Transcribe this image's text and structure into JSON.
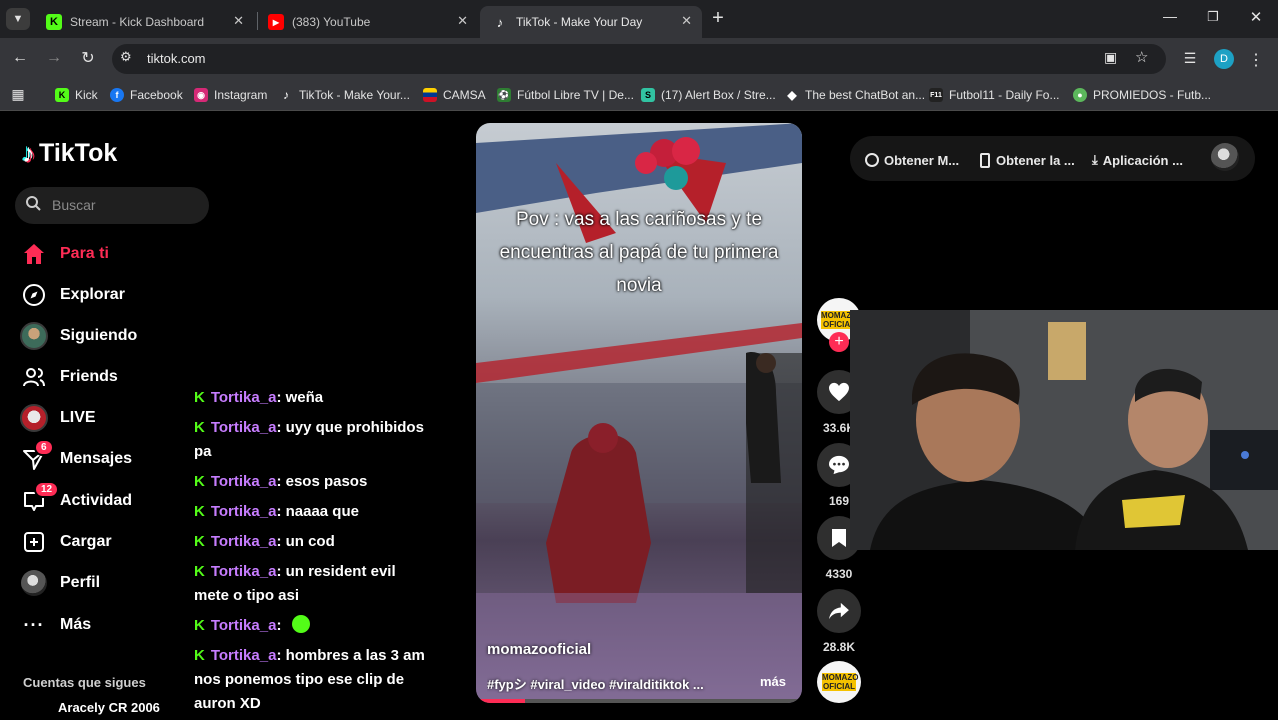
{
  "browser": {
    "tabs": [
      {
        "title": "Stream - Kick Dashboard",
        "icon": "kick-icon"
      },
      {
        "title": "(383) YouTube",
        "icon": "youtube-icon"
      },
      {
        "title": "TikTok - Make Your Day",
        "icon": "tiktok-icon"
      }
    ],
    "url": "tiktok.com",
    "profile_initial": "D",
    "bookmarks": [
      {
        "label": "Kick"
      },
      {
        "label": "Facebook"
      },
      {
        "label": "Instagram"
      },
      {
        "label": "TikTok - Make Your..."
      },
      {
        "label": "CAMSA"
      },
      {
        "label": "Fútbol Libre TV | De..."
      },
      {
        "label": "(17) Alert Box / Stre..."
      },
      {
        "label": "The best ChatBot an..."
      },
      {
        "label": "Futbol11 - Daily Fo..."
      },
      {
        "label": "PROMIEDOS - Futb..."
      }
    ]
  },
  "tiktok": {
    "logo": "TikTok",
    "search_placeholder": "Buscar",
    "nav": [
      {
        "label": "Para ti",
        "icon": "home-icon"
      },
      {
        "label": "Explorar",
        "icon": "compass-icon"
      },
      {
        "label": "Siguiendo",
        "icon": "following-avatar-icon"
      },
      {
        "label": "Friends",
        "icon": "friends-icon"
      },
      {
        "label": "LIVE",
        "icon": "live-icon"
      },
      {
        "label": "Mensajes",
        "icon": "messages-icon",
        "badge": "6"
      },
      {
        "label": "Actividad",
        "icon": "activity-icon",
        "badge": "12"
      },
      {
        "label": "Cargar",
        "icon": "upload-icon"
      },
      {
        "label": "Perfil",
        "icon": "profile-icon"
      },
      {
        "label": "Más",
        "icon": "more-icon"
      }
    ],
    "following_header": "Cuentas que sigues",
    "following_first": "Aracely CR 2006",
    "top_actions": [
      "Obtener M...",
      "Obtener la ...",
      "Aplicación ..."
    ],
    "video": {
      "caption": "Pov : vas a las cariñosas y te encuentras al papá de tu primera novia",
      "author": "momazooficial",
      "hashtags": "#fypシ #viral_video #viralditiktok ...",
      "more": "más",
      "author_avatar_text": "MOMAZO OFICIAL",
      "progress": 0.15
    },
    "actions": {
      "likes": "33.6K",
      "comments": "169",
      "saves": "4330",
      "shares": "28.8K"
    }
  },
  "chat": [
    {
      "user": "Tortika_a",
      "msg": ": weña"
    },
    {
      "user": "Tortika_a",
      "msg": ": uyy que prohibidos pa"
    },
    {
      "user": "Tortika_a",
      "msg": ": esos pasos"
    },
    {
      "user": "Tortika_a",
      "msg": ": naaaa que"
    },
    {
      "user": "Tortika_a",
      "msg": ": un cod"
    },
    {
      "user": "Tortika_a",
      "msg": ": un resident evil mete o tipo asi"
    },
    {
      "user": "Tortika_a",
      "msg": ":"
    },
    {
      "user": "Tortika_a",
      "msg": ": hombres a las 3 am nos ponemos tipo ese clip de auron XD"
    }
  ],
  "colors": {
    "accent": "#fe2c55",
    "kick_green": "#53fc18",
    "chat_user": "#c77dff"
  }
}
